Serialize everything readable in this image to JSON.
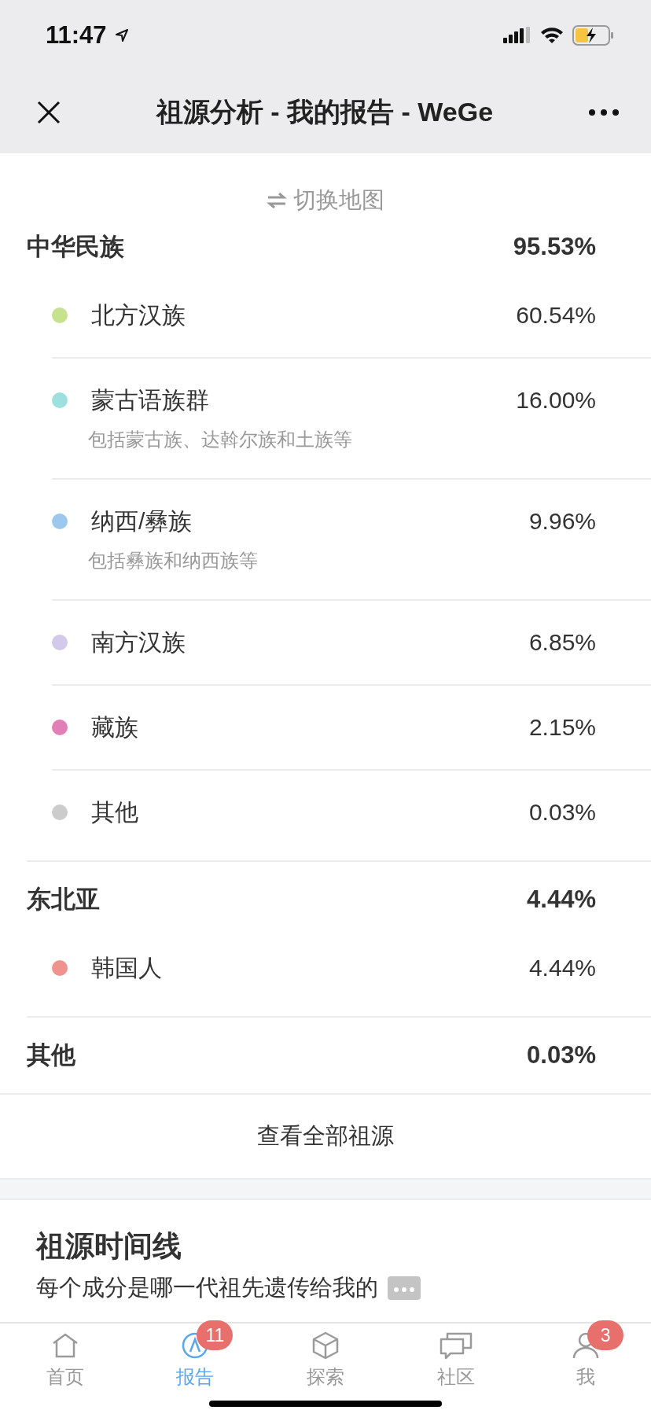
{
  "status_bar": {
    "time": "11:47"
  },
  "nav": {
    "title": "祖源分析 - 我的报告 - WeGe"
  },
  "switch_map": "切换地图",
  "groups": [
    {
      "name": "中华民族",
      "percent": "95.53%",
      "items": [
        {
          "name": "北方汉族",
          "percent": "60.54%",
          "color": "#c5e38f"
        },
        {
          "name": "蒙古语族群",
          "percent": "16.00%",
          "color": "#9ee0de",
          "note": "包括蒙古族、达斡尔族和土族等"
        },
        {
          "name": "纳西/彝族",
          "percent": "9.96%",
          "color": "#9cc8ee",
          "note": "包括彝族和纳西族等"
        },
        {
          "name": "南方汉族",
          "percent": "6.85%",
          "color": "#d3c9ea"
        },
        {
          "name": "藏族",
          "percent": "2.15%",
          "color": "#e27fb6"
        },
        {
          "name": "其他",
          "percent": "0.03%",
          "color": "#cccccc"
        }
      ]
    },
    {
      "name": "东北亚",
      "percent": "4.44%",
      "items": [
        {
          "name": "韩国人",
          "percent": "4.44%",
          "color": "#f0938e"
        }
      ]
    },
    {
      "name": "其他",
      "percent": "0.03%"
    }
  ],
  "view_all": "查看全部祖源",
  "timeline": {
    "title": "祖源时间线",
    "subtitle": "每个成分是哪一代祖先遗传给我的"
  },
  "tabs": [
    {
      "kind": "home",
      "label": "首页",
      "selected": false
    },
    {
      "kind": "report",
      "label": "报告",
      "selected": true,
      "badge": "11"
    },
    {
      "kind": "explore",
      "label": "探索",
      "selected": false
    },
    {
      "kind": "community",
      "label": "社区",
      "selected": false
    },
    {
      "kind": "me",
      "label": "我",
      "selected": false,
      "badge": "3"
    }
  ]
}
